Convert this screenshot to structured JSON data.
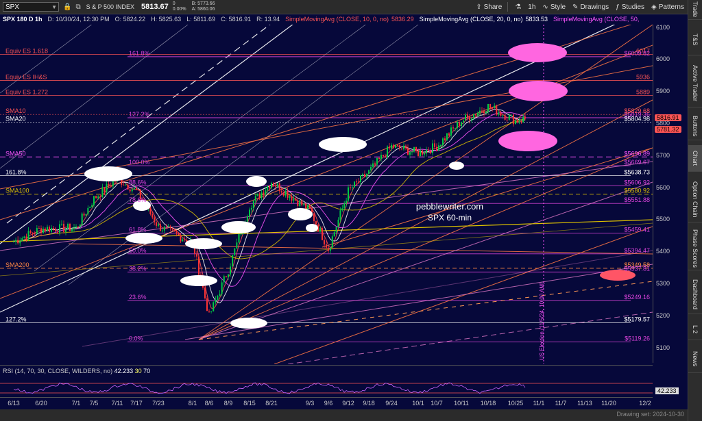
{
  "toolbar": {
    "symbol": "SPX",
    "index_name": "S & P 500 INDEX",
    "price": "5813.67",
    "change": "0",
    "change_pct": "0.00%",
    "bid": "B: 5773.66",
    "ask": "A: 5860.06",
    "share": "Share",
    "interval": "1h",
    "style": "Style",
    "drawings": "Drawings",
    "studies": "Studies",
    "patterns": "Patterns"
  },
  "infobar": {
    "title": "SPX 180 D 1h",
    "date": "D: 10/30/24, 12:30 PM",
    "open": "O: 5824.22",
    "high": "H: 5825.63",
    "low": "L: 5811.69",
    "close": "C: 5816.91",
    "range": "R: 13.94",
    "sma10": "SimpleMovingAvg (CLOSE, 10, 0, no)",
    "sma10_val": "5836.29",
    "sma20": "SimpleMovingAvg (CLOSE, 20, 0, no)",
    "sma20_val": "5833.53",
    "sma50": "SimpleMovingAvg (CLOSE, 50,"
  },
  "sidebar": [
    "Trade",
    "T&S",
    "Active Trader",
    "Buttons",
    "Chart",
    "Option Chain",
    "Phase Scores",
    "Dashboard",
    "L 2",
    "News"
  ],
  "rsi": {
    "label": "RSI (14, 70, 30, CLOSE, WILDERS, no)",
    "value": "42.233",
    "low": "30",
    "high": "70"
  },
  "watermark": {
    "line1": "pebblewriter.com",
    "line2": "SPX 60-min"
  },
  "election_label": "US Election (11/5/24, 10:00 AM)",
  "status": "Drawing set: 2024-10-30",
  "colors": {
    "background": "#06083a",
    "sma10": "#ff5555",
    "sma20": "#ffffff",
    "sma50": "#ff55ff",
    "sma100": "#dcc000",
    "fib": "#dd44dd",
    "candle_up": "#00cc44",
    "candle_down": "#ff3333",
    "highlight_pink": "#ff66e0"
  },
  "chart_data": {
    "type": "candlestick",
    "y_axis": {
      "ticks": [
        5100,
        5200,
        5300,
        5400,
        5500,
        5600,
        5700,
        5800,
        5900,
        6000,
        6100
      ],
      "ylim": [
        5050,
        6110
      ]
    },
    "x_axis": {
      "tick_labels": [
        "6/13",
        "6/20",
        "7/1",
        "7/5",
        "7/11",
        "7/17",
        "7/23",
        "8/1",
        "8/6",
        "8/9",
        "8/15",
        "8/21",
        "9/3",
        "9/6",
        "9/12",
        "9/18",
        "9/24",
        "10/1",
        "10/7",
        "10/11",
        "10/18",
        "10/25",
        "11/1",
        "11/7",
        "11/13",
        "11/20",
        "12/2"
      ]
    },
    "price_path": [
      {
        "date": "6/13",
        "close": 5433
      },
      {
        "date": "6/20",
        "close": 5473
      },
      {
        "date": "7/1",
        "close": 5475
      },
      {
        "date": "7/5",
        "close": 5567
      },
      {
        "date": "7/11",
        "close": 5630
      },
      {
        "date": "7/17",
        "close": 5590
      },
      {
        "date": "7/23",
        "close": 5480
      },
      {
        "date": "8/1",
        "close": 5430
      },
      {
        "date": "8/6",
        "close": 5200
      },
      {
        "date": "8/9",
        "close": 5345
      },
      {
        "date": "8/15",
        "close": 5545
      },
      {
        "date": "8/21",
        "close": 5620
      },
      {
        "date": "9/3",
        "close": 5530
      },
      {
        "date": "9/6",
        "close": 5410
      },
      {
        "date": "9/12",
        "close": 5590
      },
      {
        "date": "9/18",
        "close": 5650
      },
      {
        "date": "9/24",
        "close": 5730
      },
      {
        "date": "10/1",
        "close": 5710
      },
      {
        "date": "10/7",
        "close": 5730
      },
      {
        "date": "10/11",
        "close": 5810
      },
      {
        "date": "10/18",
        "close": 5855
      },
      {
        "date": "10/25",
        "close": 5810
      },
      {
        "date": "10/30",
        "close": 5817
      }
    ],
    "horizontal_levels": [
      {
        "label": "Equiv ES 1.618",
        "value": 6017,
        "value_label": "6017"
      },
      {
        "label": "161.8%",
        "value": 6009.82,
        "value_label": "$6009.82"
      },
      {
        "label": "Equiv ES IH&S",
        "value": 5936,
        "value_label": "5936"
      },
      {
        "label": "Equiv ES 1.272",
        "value": 5889,
        "value_label": "5889"
      },
      {
        "label": "127.2%",
        "value": 5819.36,
        "value_label": "$5819.36"
      },
      {
        "label": "SMA10",
        "value": 5829.68,
        "value_label": "$5829.68"
      },
      {
        "label": "SMA20",
        "value": 5804.98,
        "value_label": "$5804.98"
      },
      {
        "label": "SMA50",
        "value": 5696.89,
        "value_label": "$5696.89"
      },
      {
        "label": "100.0%",
        "value": 5669.67,
        "value_label": "$5669.67"
      },
      {
        "label": "161.8%",
        "value": 5638.73,
        "value_label": "$5638.73"
      },
      {
        "label": "88.6%",
        "value": 5606.92,
        "value_label": "$5606.92"
      },
      {
        "label": "SMA100",
        "value": 5580.92,
        "value_label": "$5580.92"
      },
      {
        "label": "78.6%",
        "value": 5551.88,
        "value_label": "$5551.88"
      },
      {
        "label": "61.8%",
        "value": 5459.41,
        "value_label": "$5459.41"
      },
      {
        "label": "50.0%",
        "value": 5394.47,
        "value_label": "$5394.47"
      },
      {
        "label": "SMA200",
        "value": 5349.58,
        "value_label": "$5349.58"
      },
      {
        "label": "38.2%",
        "value": 5337.81,
        "value_label": "$5337.81"
      },
      {
        "label": "23.6%",
        "value": 5249.16,
        "value_label": "$5249.16"
      },
      {
        "label": "127.2%",
        "value": 5179.57,
        "value_label": "$5179.57"
      },
      {
        "label": "0.0%",
        "value": 5119.26,
        "value_label": "$5119.26"
      }
    ],
    "y_badges": [
      {
        "value": 5816.91,
        "label": "5816.91",
        "bg": "#ff5555",
        "fg": "#000000"
      },
      {
        "value": 5781.32,
        "label": "5781.32",
        "bg": "#ff5555",
        "fg": "#000000"
      }
    ]
  }
}
